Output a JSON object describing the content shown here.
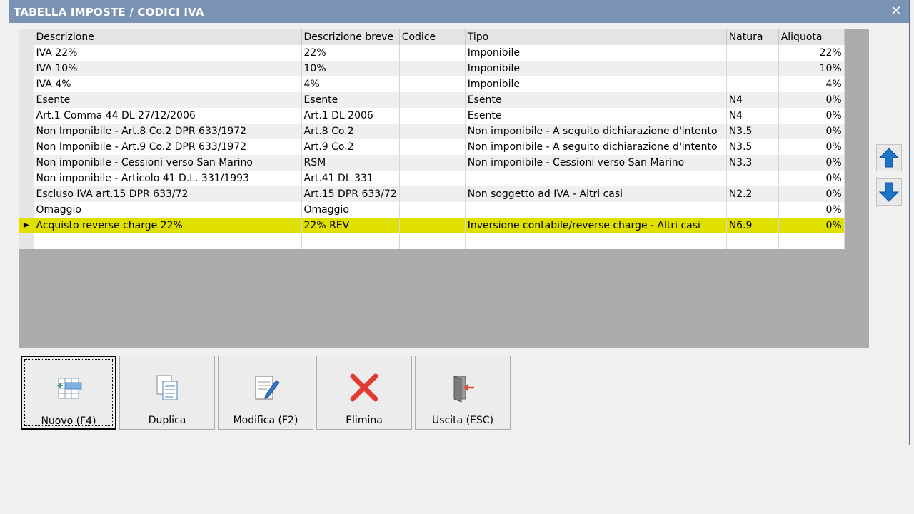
{
  "window": {
    "title": "TABELLA IMPOSTE / CODICI IVA",
    "close_glyph": "✕"
  },
  "grid": {
    "columns": [
      "Descrizione",
      "Descrizione breve",
      "Codice",
      "Tipo",
      "Natura",
      "Aliquota"
    ],
    "rows": [
      [
        "IVA 22%",
        "22%",
        "",
        "Imponibile",
        "",
        "22%"
      ],
      [
        "IVA 10%",
        "10%",
        "",
        "Imponibile",
        "",
        "10%"
      ],
      [
        "IVA 4%",
        "4%",
        "",
        "Imponibile",
        "",
        "4%"
      ],
      [
        "Esente",
        "Esente",
        "",
        "Esente",
        "N4",
        "0%"
      ],
      [
        "Art.1 Comma 44 DL 27/12/2006",
        "Art.1 DL 2006",
        "",
        "Esente",
        "N4",
        "0%"
      ],
      [
        "Non Imponibile - Art.8 Co.2 DPR 633/1972",
        "Art.8 Co.2",
        "",
        "Non imponibile - A seguito dichiarazione d'intento",
        "N3.5",
        "0%"
      ],
      [
        "Non Imponibile - Art.9 Co.2 DPR 633/1972",
        "Art.9 Co.2",
        "",
        "Non imponibile - A seguito dichiarazione d'intento",
        "N3.5",
        "0%"
      ],
      [
        "Non imponibile - Cessioni verso San Marino",
        "RSM",
        "",
        "Non imponibile - Cessioni verso San Marino",
        "N3.3",
        "0%"
      ],
      [
        "Non imponibile - Articolo 41 D.L. 331/1993",
        "Art.41 DL 331",
        "",
        "",
        "",
        "0%"
      ],
      [
        "Escluso IVA art.15 DPR 633/72",
        "Art.15 DPR 633/72",
        "",
        "Non soggetto ad IVA - Altri casi",
        "N2.2",
        "0%"
      ],
      [
        "Omaggio",
        "Omaggio",
        "",
        "",
        "",
        "0%"
      ],
      [
        "Acquisto reverse charge 22%",
        "22% REV",
        "",
        "Inversione contabile/reverse charge - Altri casi",
        "N6.9",
        "0%"
      ],
      [
        "",
        "",
        "",
        "",
        "",
        ""
      ]
    ],
    "selected_row_index": 11,
    "highlight_color": "#e0e000"
  },
  "side_buttons": {
    "up_icon": "arrow-up-icon",
    "down_icon": "arrow-down-icon"
  },
  "buttons": [
    {
      "label": "Nuovo (F4)",
      "icon": "new-record-icon",
      "default": true
    },
    {
      "label": "Duplica",
      "icon": "duplicate-icon",
      "default": false
    },
    {
      "label": "Modifica (F2)",
      "icon": "edit-icon",
      "default": false
    },
    {
      "label": "Elimina",
      "icon": "delete-icon",
      "default": false
    },
    {
      "label": "Uscita (ESC)",
      "icon": "exit-icon",
      "default": false
    }
  ]
}
